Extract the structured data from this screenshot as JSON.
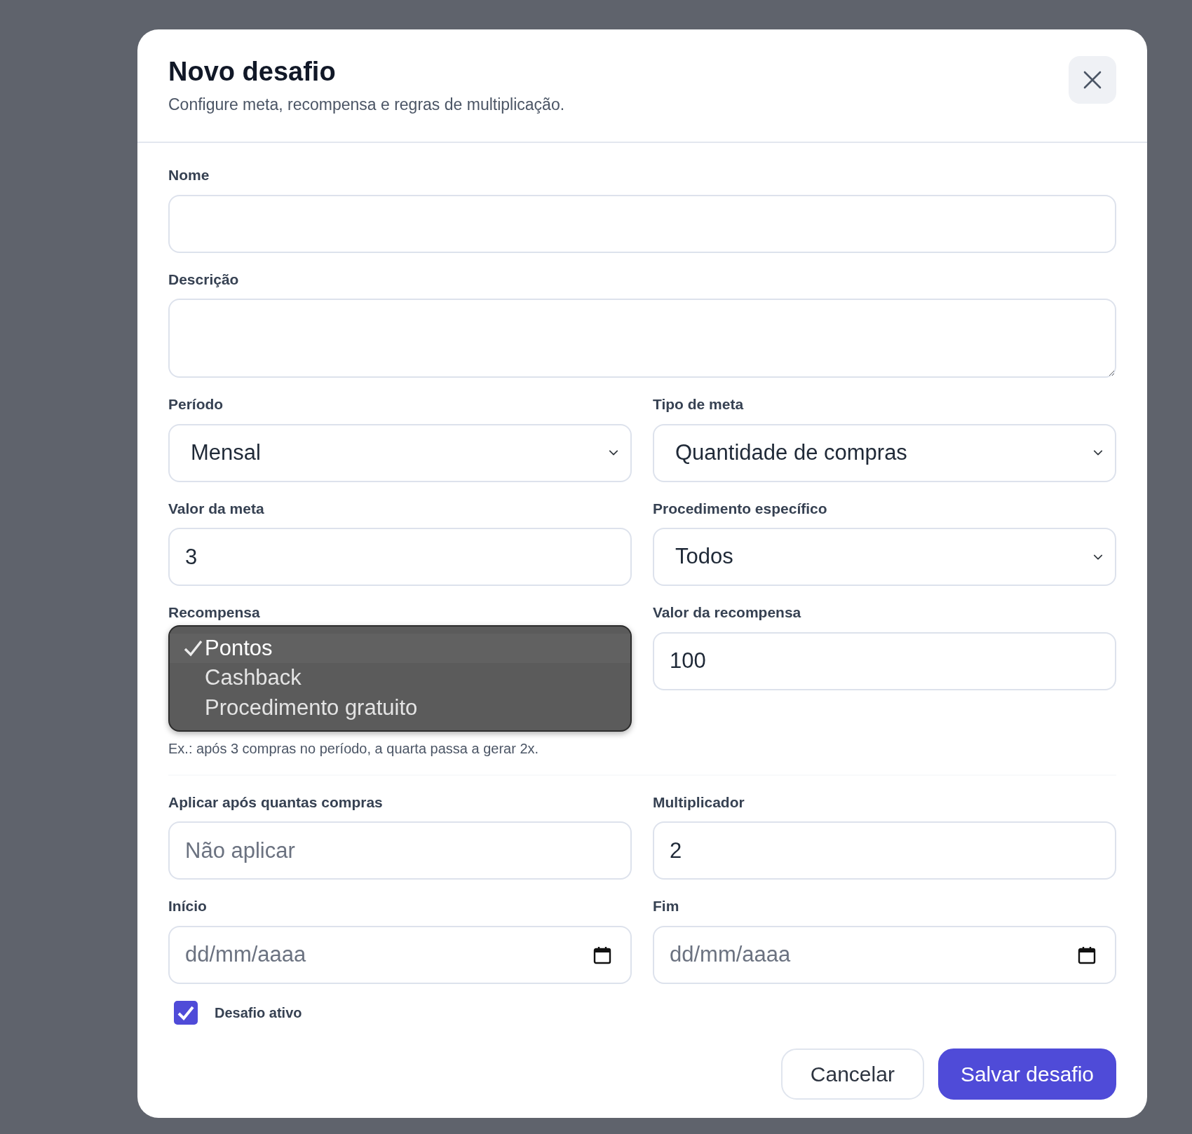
{
  "dialog": {
    "title": "Novo desafio",
    "subtitle": "Configure meta, recompensa e regras de multiplicação."
  },
  "fields": [
    {
      "kind": "text",
      "label": "Nome"
    },
    {
      "kind": "textarea",
      "label": "Descrição"
    },
    {
      "kind": "select",
      "label": "Período",
      "value": "Mensal"
    },
    {
      "kind": "select",
      "label": "Tipo de meta",
      "value": "Quantidade de compras"
    },
    {
      "kind": "text",
      "label": "Valor da meta",
      "value": "3"
    },
    {
      "kind": "select",
      "label": "Procedimento específico",
      "value": "Todos"
    },
    {
      "kind": "menu",
      "label": "Recompensa",
      "options": [
        {
          "label": "Pontos",
          "selected": true
        },
        {
          "label": "Cashback",
          "selected": false
        },
        {
          "label": "Procedimento gratuito",
          "selected": false
        }
      ]
    },
    {
      "kind": "text",
      "label": "Valor da recompensa",
      "value": "100"
    },
    {
      "kind": "hint",
      "text": "Ex.: após 3 compras no período, a quarta passa a gerar 2x."
    },
    {
      "kind": "divider"
    },
    {
      "kind": "text",
      "label": "Aplicar após quantas compras",
      "placeholder": "Não aplicar"
    },
    {
      "kind": "text",
      "label": "Multiplicador",
      "value": "2"
    },
    {
      "kind": "date",
      "label": "Início",
      "placeholder": "dd/mm/aaaa"
    },
    {
      "kind": "date",
      "label": "Fim",
      "placeholder": "dd/mm/aaaa"
    }
  ],
  "active": {
    "label": "Desafio ativo",
    "checked": true
  },
  "buttons": [
    {
      "label": "Cancelar",
      "kind": "secondary"
    },
    {
      "label": "Salvar desafio",
      "kind": "primary"
    }
  ]
}
